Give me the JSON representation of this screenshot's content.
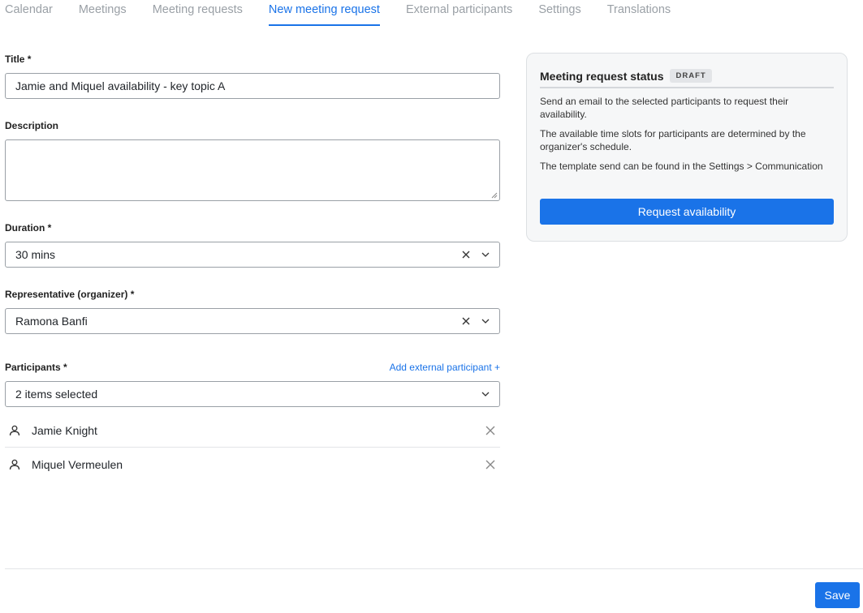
{
  "tabs": [
    {
      "label": "Calendar"
    },
    {
      "label": "Meetings"
    },
    {
      "label": "Meeting requests"
    },
    {
      "label": "New meeting request"
    },
    {
      "label": "External participants"
    },
    {
      "label": "Settings"
    },
    {
      "label": "Translations"
    }
  ],
  "active_tab": "New meeting request",
  "form": {
    "title_label": "Title *",
    "title_value": "Jamie and Miquel availability - key topic A",
    "description_label": "Description",
    "description_value": "",
    "duration_label": "Duration *",
    "duration_value": "30 mins",
    "representative_label": "Representative (organizer) *",
    "representative_value": "Ramona Banfi",
    "participants_label": "Participants *",
    "add_external_link": "Add external participant +",
    "participants_select_value": "2 items selected",
    "participants": [
      {
        "name": "Jamie Knight"
      },
      {
        "name": "Miquel Vermeulen"
      }
    ]
  },
  "status_card": {
    "title": "Meeting request status",
    "badge": "DRAFT",
    "paragraphs": [
      "Send an email to the selected participants to request their availability.",
      "The available time slots for participants are determined by the organizer's schedule.",
      "The template send can be found in the Settings > Communication"
    ],
    "button_label": "Request availability"
  },
  "footer": {
    "save_label": "Save"
  },
  "colors": {
    "accent": "#1a73e8",
    "tab_inactive": "#9aa0a6",
    "card_bg": "#f6f7f8"
  },
  "icons": {
    "clear": "close-icon",
    "dropdown": "chevron-down-icon",
    "participant": "user-icon",
    "remove": "close-icon"
  }
}
